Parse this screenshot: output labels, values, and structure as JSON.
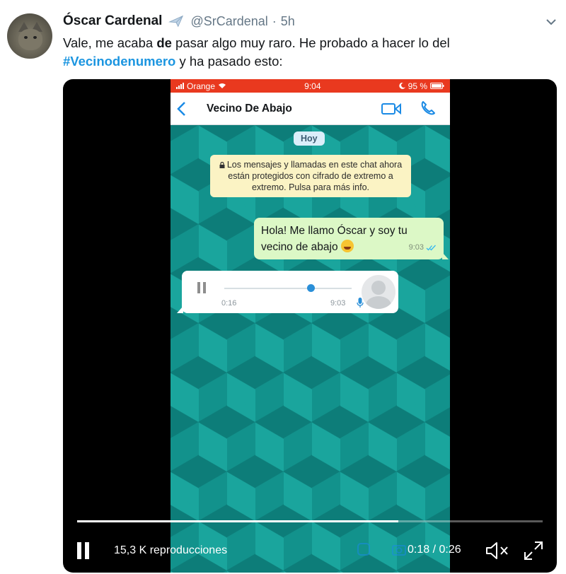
{
  "tweet": {
    "display_name": "Óscar Cardenal",
    "handle": "@SrCardenal",
    "separator": "·",
    "time": "5h",
    "text_part1": "Vale, me acaba ",
    "text_bold": "de",
    "text_part2": " pasar algo muy raro. He probado a hacer lo del ",
    "hashtag": "#Vecinodenumero",
    "text_part3": " y ha pasado esto:"
  },
  "phone": {
    "carrier": "Orange",
    "clock": "9:04",
    "battery": "95 %",
    "contact_name": "Vecino De Abajo",
    "day_label": "Hoy",
    "encryption_notice": "Los mensajes y llamadas en este chat ahora están protegidos con cifrado de extremo a extremo. Pulsa para más info.",
    "outgoing_message": "Hola! Me llamo Óscar y soy tu vecino de abajo",
    "outgoing_time": "9:03",
    "voice_duration": "0:16",
    "voice_time": "9:03",
    "voice_progress": 0.68
  },
  "video": {
    "views": "15,3 K reproducciones",
    "elapsed": "0:18",
    "separator": " / ",
    "duration": "0:26",
    "progress": 0.69
  },
  "colors": {
    "link": "#1b95e0",
    "whatsapp_bubble": "#dcf8c6",
    "status_bar": "#e9391f"
  }
}
